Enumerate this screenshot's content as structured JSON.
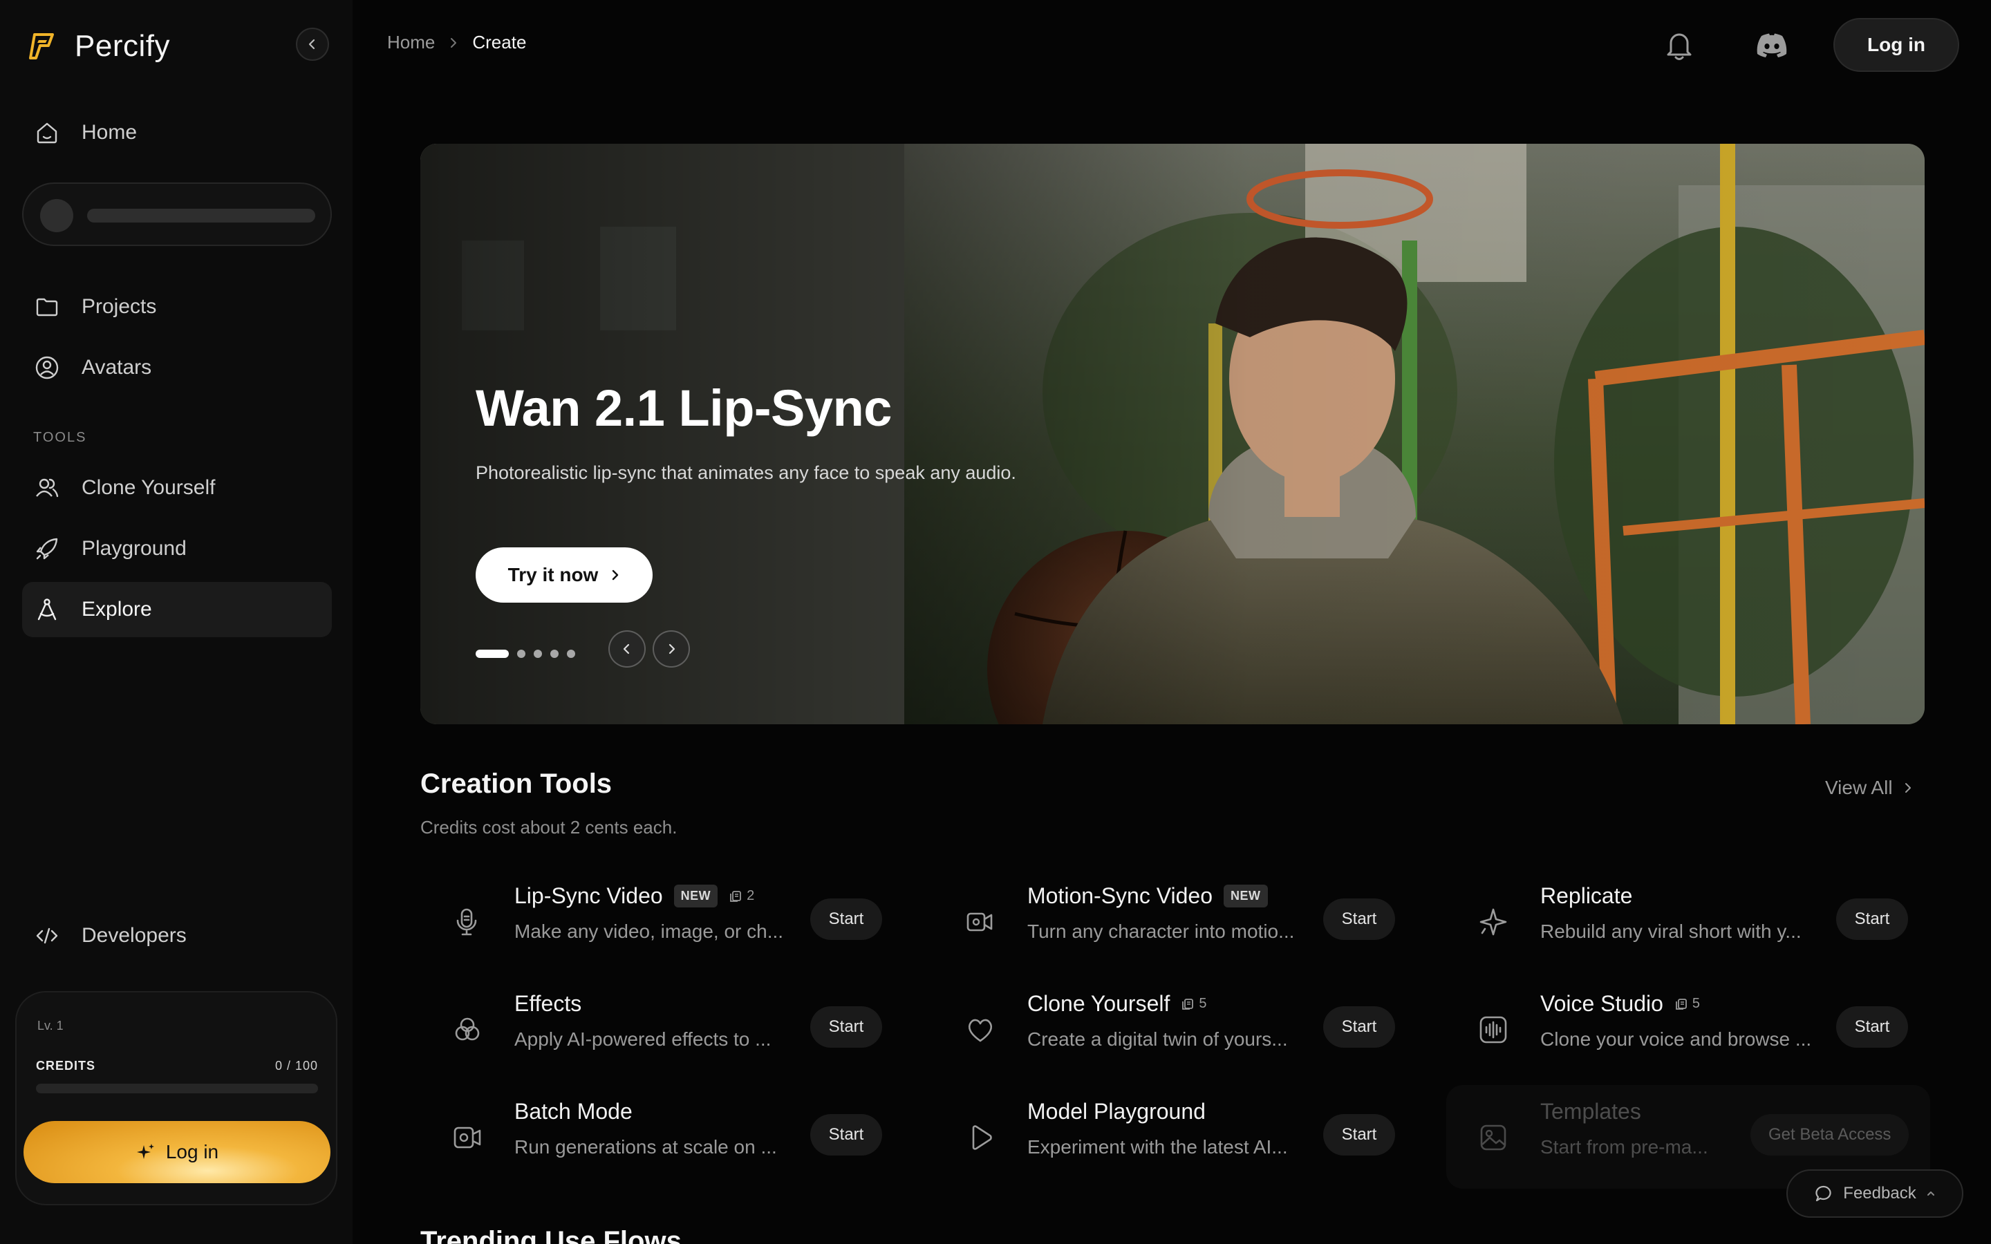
{
  "app": {
    "name": "Percify"
  },
  "breadcrumb": {
    "home": "Home",
    "current": "Create"
  },
  "header": {
    "login": "Log in"
  },
  "sidebar": {
    "home": "Home",
    "projects": "Projects",
    "avatars": "Avatars",
    "tools_label": "TOOLS",
    "clone_yourself": "Clone Yourself",
    "playground": "Playground",
    "explore": "Explore",
    "developers": "Developers",
    "level": "Lv. 1",
    "credits_label": "CREDITS",
    "credits_value": "0 / 100",
    "credits_fraction": 0,
    "login": "Log in"
  },
  "hero": {
    "title": "Wan 2.1 Lip-Sync",
    "subtitle": "Photorealistic lip-sync that animates any face to speak any audio.",
    "cta": "Try it now",
    "slide_count": 5,
    "active_slide": 1
  },
  "tools_section": {
    "title": "Creation Tools",
    "subtitle": "Credits cost about 2 cents each.",
    "view_all": "View All",
    "start_label": "Start",
    "new_label": "NEW",
    "items": [
      {
        "name": "Lip-Sync Video",
        "desc": "Make any video, image, or ch...",
        "new": true,
        "cost": "2",
        "icon": "microphone-icon"
      },
      {
        "name": "Motion-Sync Video",
        "desc": "Turn any character into motio...",
        "new": true,
        "cost": "",
        "icon": "video-camera-icon"
      },
      {
        "name": "Replicate",
        "desc": "Rebuild any viral short with y...",
        "new": false,
        "cost": "",
        "icon": "sparkle-icon"
      },
      {
        "name": "Effects",
        "desc": "Apply AI-powered effects to ...",
        "new": false,
        "cost": "",
        "icon": "circles-icon"
      },
      {
        "name": "Clone Yourself",
        "desc": "Create a digital twin of yours...",
        "new": false,
        "cost": "5",
        "icon": "heart-icon"
      },
      {
        "name": "Voice Studio",
        "desc": "Clone your voice and browse ...",
        "new": false,
        "cost": "5",
        "icon": "waveform-icon"
      },
      {
        "name": "Batch Mode",
        "desc": "Run generations at scale on ...",
        "new": false,
        "cost": "",
        "icon": "batch-camera-icon"
      },
      {
        "name": "Model Playground",
        "desc": "Experiment with the latest AI...",
        "new": false,
        "cost": "",
        "icon": "play-icon"
      },
      {
        "name": "Templates",
        "desc": "Start from pre-ma...",
        "new": false,
        "cost": "",
        "icon": "image-icon",
        "action": "Get Beta Access"
      }
    ]
  },
  "feedback": "Feedback",
  "trending_title": "Trending Use Flows",
  "colors": {
    "accent": "#e8a21f",
    "background": "#050505",
    "sidebar": "#0c0c0c"
  }
}
